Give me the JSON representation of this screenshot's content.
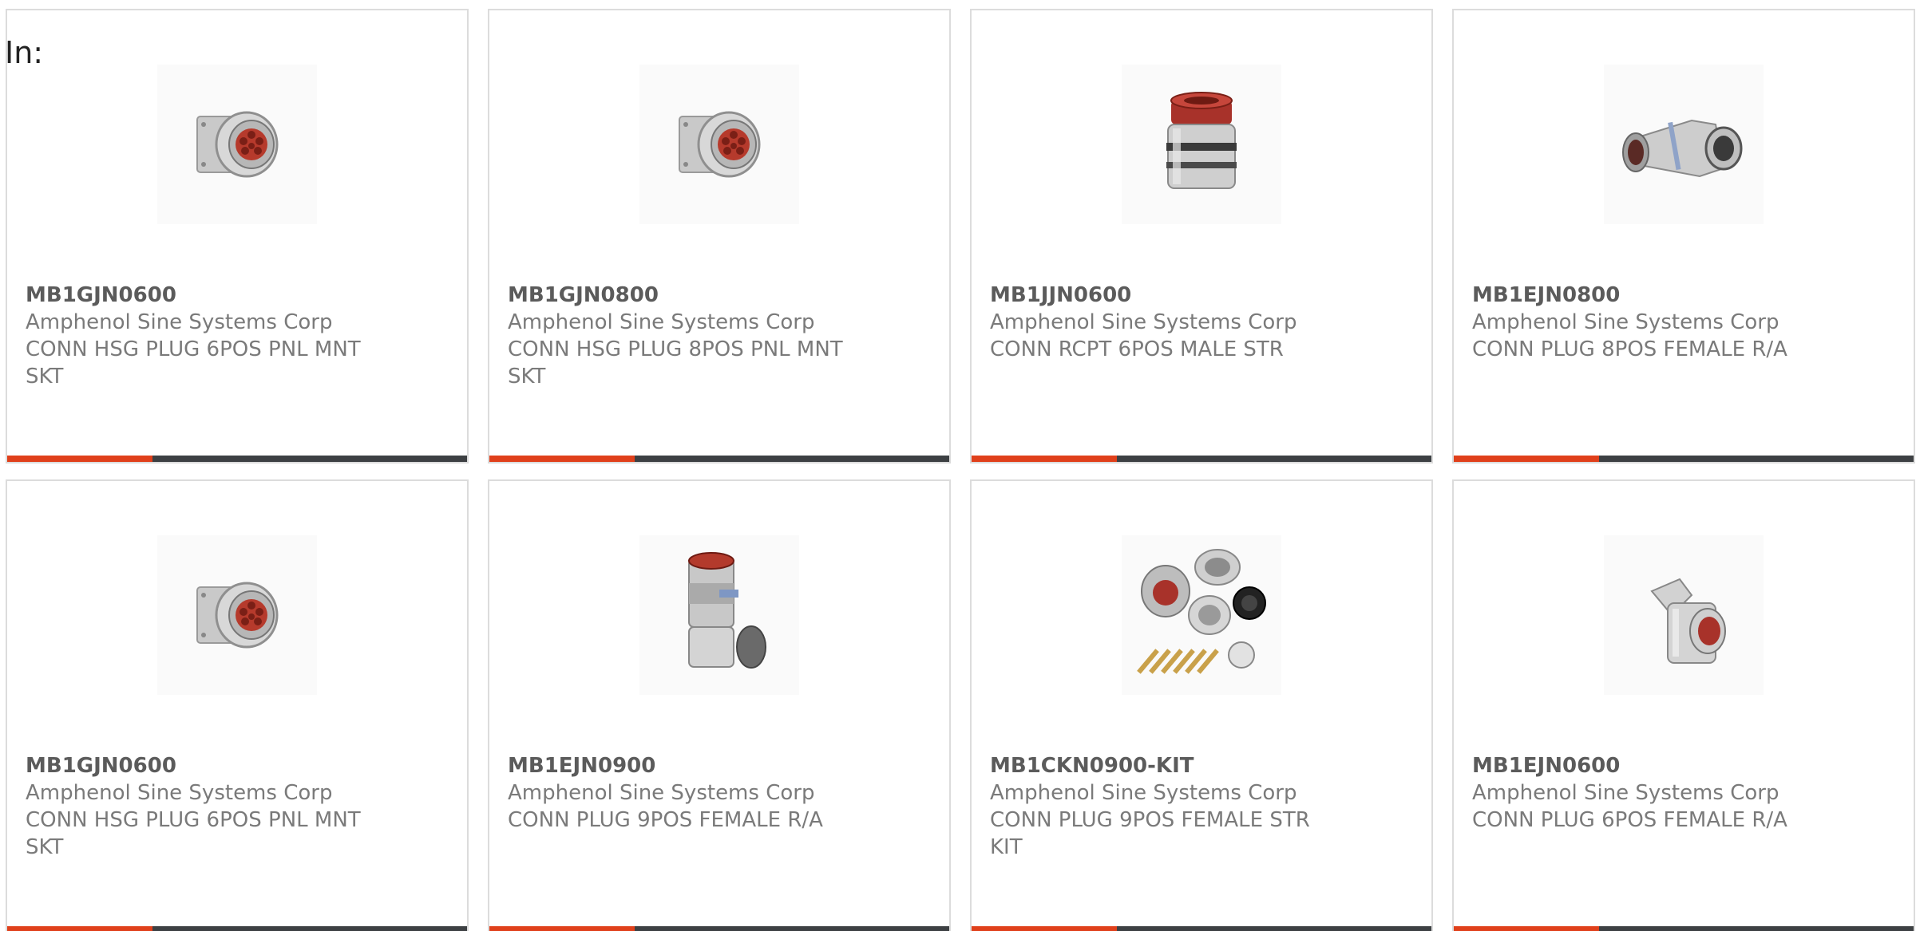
{
  "header": {
    "label": "In:"
  },
  "products": [
    {
      "part": "MB1GJN0600",
      "manufacturer": "Amphenol Sine Systems Corp",
      "desc1": "CONN HSG PLUG 6POS PNL MNT",
      "desc2": "SKT",
      "icon": "panel-mount-plug-image"
    },
    {
      "part": "MB1GJN0800",
      "manufacturer": "Amphenol Sine Systems Corp",
      "desc1": "CONN HSG PLUG 8POS PNL MNT",
      "desc2": "SKT",
      "icon": "panel-mount-plug-image"
    },
    {
      "part": "MB1JJN0600",
      "manufacturer": "Amphenol Sine Systems Corp",
      "desc1": "CONN RCPT 6POS MALE STR",
      "desc2": "",
      "icon": "straight-receptacle-image"
    },
    {
      "part": "MB1EJN0800",
      "manufacturer": "Amphenol Sine Systems Corp",
      "desc1": "CONN PLUG 8POS FEMALE R/A",
      "desc2": "",
      "icon": "right-angle-plug-image"
    },
    {
      "part": "MB1GJN0600",
      "manufacturer": "Amphenol Sine Systems Corp",
      "desc1": "CONN HSG PLUG 6POS PNL MNT",
      "desc2": "SKT",
      "icon": "panel-mount-plug-image"
    },
    {
      "part": "MB1EJN0900",
      "manufacturer": "Amphenol Sine Systems Corp",
      "desc1": "CONN PLUG 9POS FEMALE R/A",
      "desc2": "",
      "icon": "right-angle-plug-image"
    },
    {
      "part": "MB1CKN0900-KIT",
      "manufacturer": "Amphenol Sine Systems Corp",
      "desc1": "CONN PLUG 9POS FEMALE STR",
      "desc2": "KIT",
      "icon": "connector-kit-image"
    },
    {
      "part": "MB1EJN0600",
      "manufacturer": "Amphenol Sine Systems Corp",
      "desc1": "CONN PLUG 6POS FEMALE R/A",
      "desc2": "",
      "icon": "right-angle-plug-image"
    }
  ],
  "colors": {
    "accent": "#e0401b",
    "bar": "#3d4043",
    "border": "#dcdcdc"
  }
}
